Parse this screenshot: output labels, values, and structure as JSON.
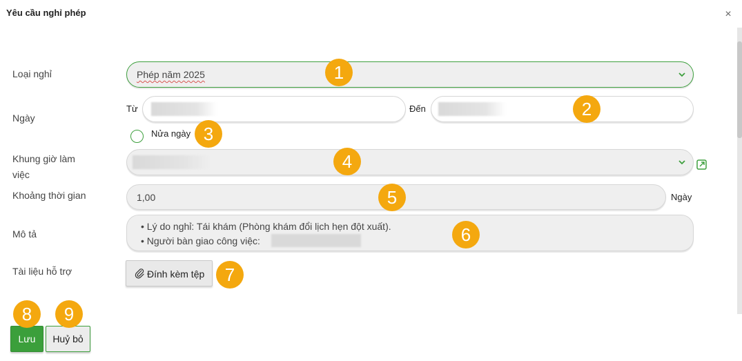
{
  "dialog": {
    "title": "Yêu cầu nghỉ phép",
    "close_glyph": "×"
  },
  "form": {
    "leave_type": {
      "label": "Loại nghỉ",
      "value": "Phép năm 2025"
    },
    "date": {
      "label": "Ngày",
      "from_label": "Từ",
      "to_label": "Đến"
    },
    "half_day": {
      "label": "Nửa ngày"
    },
    "work_schedule": {
      "label_line1": "Khung giờ làm",
      "label_line2": "việc",
      "external_icon": "external-link-icon"
    },
    "duration": {
      "label": "Khoảng thời gian",
      "value": "1,00",
      "unit": "Ngày"
    },
    "description": {
      "label": "Mô tả",
      "line1": "• Lý do nghỉ: Tái khám (Phòng khám đổi lịch hẹn đột xuất).",
      "line2": "• Người bàn giao công việc:"
    },
    "attachments": {
      "label": "Tài liệu hỗ trợ",
      "button_label": "Đính kèm tệp",
      "icon": "paperclip-icon"
    }
  },
  "actions": {
    "save_label": "Lưu",
    "cancel_label": "Huỷ bỏ"
  },
  "annotations": [
    "1",
    "2",
    "3",
    "4",
    "5",
    "6",
    "7",
    "8",
    "9"
  ],
  "colors": {
    "accent_green": "#3b9f3b",
    "badge_orange": "#f4a80f"
  }
}
